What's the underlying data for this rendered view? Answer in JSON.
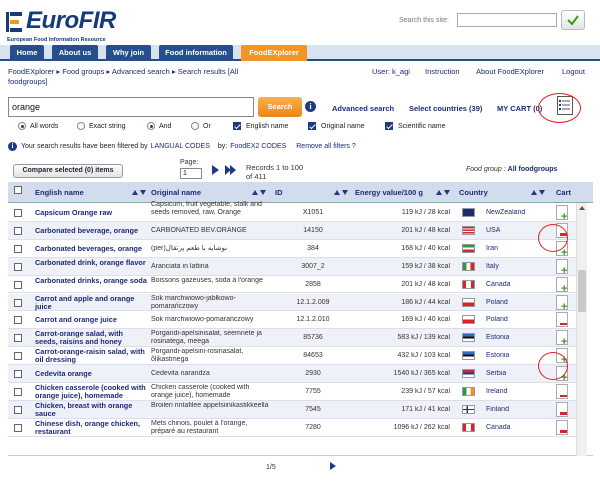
{
  "brand": {
    "name": "EuroFIR",
    "subtitle": "European Food Information Resource",
    "colors": {
      "navy": "#163a7a",
      "orange": "#f29525",
      "nav_blue": "#244e8c",
      "highlight_red": "#e31d23"
    }
  },
  "site_search": {
    "label": "Search this site:",
    "value": "",
    "button_icon": "check-icon"
  },
  "nav": {
    "items": [
      {
        "label": "Home",
        "active": false
      },
      {
        "label": "About us",
        "active": false
      },
      {
        "label": "Why join",
        "active": false
      },
      {
        "label": "Food information",
        "active": false
      },
      {
        "label": "FoodEXplorer",
        "active": true
      }
    ]
  },
  "breadcrumb": {
    "items": [
      "FoodEXplorer",
      "Food groups",
      "Advanced search",
      "Search results [All foodgroups]"
    ],
    "separator": "▸"
  },
  "top_links": {
    "user": "User: k_agi",
    "instruction": "Instruction",
    "about": "About FoodEXplorer",
    "logout": "Logout"
  },
  "search": {
    "value": "orange",
    "button": "Search",
    "advanced_search": "Advanced search",
    "select_countries": "Select countries (39)",
    "my_cart": "MY CART (0)"
  },
  "options": {
    "all_words": "All words",
    "exact_string": "Exact string",
    "and": "And",
    "or": "Or",
    "english_name": "English name",
    "original_name": "Original name",
    "scientific_name": "Scientific name",
    "all_words_selected": true,
    "and_selected": true,
    "english_checked": true,
    "original_checked": true,
    "scientific_checked": true
  },
  "filter": {
    "text": "Your search results have been filtered by",
    "langual": "LANGUAL CODES",
    "by": "by:",
    "foodex": "FoodEX2 CODES",
    "remove": "Remove all filters ?"
  },
  "results_bar": {
    "compare": "Compare selected (0) items",
    "page_label": "Page:",
    "page_value": "1",
    "records_line1": "Records  1  to  100",
    "records_line2": "of  411",
    "foodgroup_label": "Food group :",
    "foodgroup_value": "All foodgroups"
  },
  "table": {
    "headers": {
      "english": "English name",
      "original": "Original name",
      "id": "ID",
      "energy": "Energy value/100 g",
      "country": "Country",
      "cart": "Cart"
    },
    "rows": [
      {
        "english": "Capsicum Orange raw",
        "original": "Capsicum, fruit vegetable, stalk and seeds removed, raw, Orange",
        "id": "X1051",
        "energy": "119 kJ / 28 kcal",
        "country": "NewZealand",
        "flag": "nz",
        "cart": "add"
      },
      {
        "english": "Carbonated beverage, orange",
        "original": "CARBONATED BEV.ORANGE",
        "id": "14150",
        "energy": "201 kJ / 48 kcal",
        "country": "USA",
        "flag": "us",
        "cart": "remove"
      },
      {
        "english": "Carbonated beverages, orange",
        "original": "(per)نوشابه با طعم پرتقال",
        "id": "384",
        "energy": "168 kJ / 40 kcal",
        "country": "Iran",
        "flag": "ir",
        "cart": "add"
      },
      {
        "english": "Carbonated drink, orange flavor",
        "original": "Aranciata in lattina",
        "id": "3007_2",
        "energy": "159 kJ / 38 kcal",
        "country": "Italy",
        "flag": "it",
        "cart": "add"
      },
      {
        "english": "Carbonated drinks, orange soda",
        "original": "Boissons gazeuses, soda à l'orange",
        "id": "2858",
        "energy": "201 kJ / 48 kcal",
        "country": "Canada",
        "flag": "ca",
        "cart": "add"
      },
      {
        "english": "Carrot and apple and orange juice",
        "original": "Sok marchwiowo-jabłkowo-pomarańczowy",
        "id": "12.1.2.009",
        "energy": "186 kJ / 44 kcal",
        "country": "Poland",
        "flag": "pl",
        "cart": "add"
      },
      {
        "english": "Carrot and orange juice",
        "original": "Sok marchwiowo-pomarańczowy",
        "id": "12.1.2.010",
        "energy": "169 kJ / 40 kcal",
        "country": "Poland",
        "flag": "pl",
        "cart": "remove"
      },
      {
        "english": "Carrot-orange salad, with seeds, raisins and honey",
        "original": "Porgandi-apelsinisalat, seemnete ja rosinatega, meega",
        "id": "85736",
        "energy": "583 kJ / 139 kcal",
        "country": "Estonia",
        "flag": "ee",
        "cart": "add"
      },
      {
        "english": "Carrot-orange-raisin salad, with oil dressing",
        "original": "Porgandi-apelsini-rosinasalat, õlikastmega",
        "id": "84653",
        "energy": "432 kJ / 103 kcal",
        "country": "Estonia",
        "flag": "ee",
        "cart": "add"
      },
      {
        "english": "Cedevita orange",
        "original": "Cedevita narandza",
        "id": "2930",
        "energy": "1540 kJ / 365 kcal",
        "country": "Serbia",
        "flag": "rs",
        "cart": "add"
      },
      {
        "english": "Chicken casserole (cooked with orange juice), homemade",
        "original": "Chicken casserole (cooked with orange juice), homemade",
        "id": "7755",
        "energy": "239 kJ / 57 kcal",
        "country": "Ireland",
        "flag": "ie",
        "cart": "remove"
      },
      {
        "english": "Chicken, breast with orange sauce",
        "original": "Broileri rintafilee appelsiinikastikkeella",
        "id": "7545",
        "energy": "171 kJ / 41 kcal",
        "country": "Finland",
        "flag": "fi",
        "cart": "remove"
      },
      {
        "english": "Chinese dish, orange chicken, restaurant",
        "original": "Mets chinois, poulet à l'orange, préparé au restaurant",
        "id": "7280",
        "energy": "1096 kJ / 262 kcal",
        "country": "Canada",
        "flag": "ca",
        "cart": "remove"
      }
    ]
  },
  "pager": {
    "text": "1/5"
  }
}
